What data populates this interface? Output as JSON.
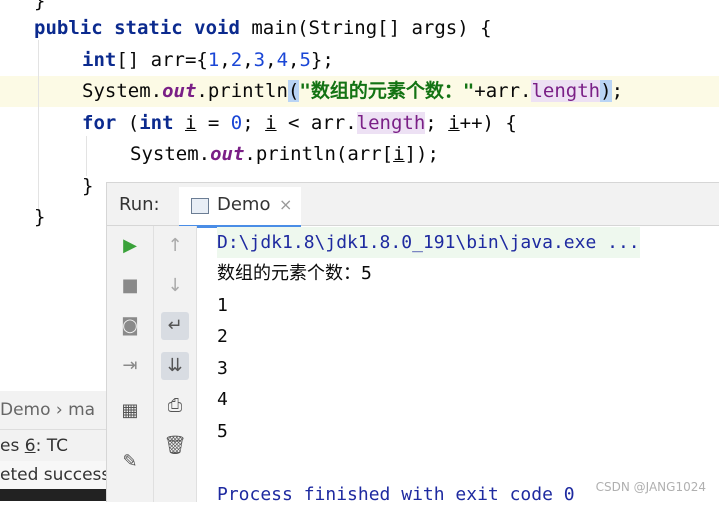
{
  "editor": {
    "top_brace": "}",
    "sig_kw": "public static void",
    "sig_rest": " main(String[] args) {",
    "arr_kw": "int",
    "arr_mid": "[] arr={",
    "n1": "1",
    "n2": "2",
    "n3": "3",
    "n4": "4",
    "n5": "5",
    "arr_end": "};",
    "print_sys": "System.",
    "print_out": "out",
    "print_method": ".println",
    "print_open": "(",
    "print_str": "\"数组的元素个数：\"",
    "print_concat": "+arr.",
    "print_len": "length",
    "print_close": ")",
    "print_semi": ";",
    "for_kw": "for",
    "for_open": " (",
    "for_int": "int",
    "for_i1": "i",
    "for_eq": " = ",
    "for_zero": "0",
    "for_semi": "; ",
    "for_i2": "i",
    "for_lt": " < arr.",
    "for_len": "length",
    "for_semi2": "; ",
    "for_i3": "i",
    "for_end": "++) {",
    "inner_sys": "System.",
    "inner_out": "out",
    "inner_method": ".println(arr[",
    "inner_i": "i",
    "inner_end": "]);",
    "close_for": "}",
    "close_main": "}"
  },
  "fragments": {
    "crumb": "Demo  ›  ma",
    "tabs": "es      ",
    "tab6_num": "6",
    "tab6_label": ": TC",
    "status": "eted successf"
  },
  "run": {
    "label": "Run:",
    "tab": "Demo",
    "close": "×"
  },
  "toolbar_left": [
    "play-icon",
    "stop-icon",
    "camera-icon",
    "login-icon",
    "layout-icon",
    "print-icon",
    "pin-icon"
  ],
  "toolbar_right": [
    "arrow-up-icon",
    "arrow-down-icon",
    "soft-wrap-icon",
    "scroll-end-icon",
    "printer-icon",
    "trash-icon"
  ],
  "console": {
    "cmd": "D:\\jdk1.8\\jdk1.8.0_191\\bin\\java.exe ...",
    "count_line": "数组的元素个数：5",
    "lines": [
      "1",
      "2",
      "3",
      "4",
      "5"
    ],
    "finish": "Process finished with exit code 0"
  },
  "watermark": "CSDN @JANG1024",
  "colors": {
    "keyword": "#0b2a8e",
    "string": "#137313",
    "field": "#7a1f86",
    "number": "#1a46d6",
    "tab_underline": "#4a8de6"
  }
}
